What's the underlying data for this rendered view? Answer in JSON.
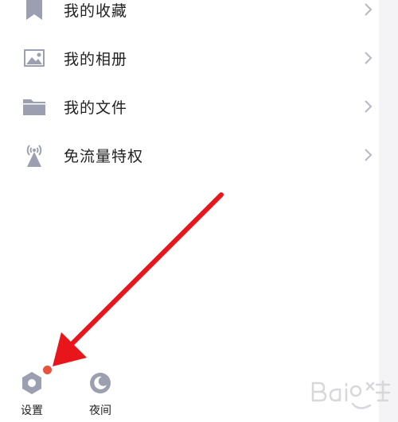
{
  "menu": {
    "items": [
      {
        "label": "我的收藏",
        "icon": "bookmark-icon"
      },
      {
        "label": "我的相册",
        "icon": "image-icon"
      },
      {
        "label": "我的文件",
        "icon": "folder-icon"
      },
      {
        "label": "免流量特权",
        "icon": "broadcast-tower-icon"
      }
    ]
  },
  "bottom_bar": {
    "settings_label": "设置",
    "night_label": "夜间"
  },
  "colors": {
    "icon_gray": "#9b9fb0",
    "badge_red": "#e8533f",
    "arrow_red": "#e8161b"
  }
}
